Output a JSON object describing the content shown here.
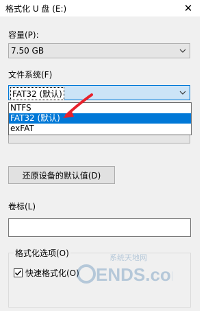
{
  "window": {
    "title": "格式化 U 盘 (E:)",
    "close_glyph": "✕"
  },
  "capacity": {
    "label": "容量(P):",
    "value": "7.50 GB"
  },
  "filesystem": {
    "label": "文件系统(F)",
    "value": "FAT32 (默认)",
    "options": [
      "NTFS",
      "FAT32 (默认)",
      "exFAT"
    ],
    "selected_index": 1
  },
  "restore_button": {
    "label": "还原设备的默认值(D)"
  },
  "volume_label": {
    "label": "卷标(L)",
    "value": ""
  },
  "format_options": {
    "title": "格式化选项(O)",
    "quick_format": {
      "label": "快速格式化(O)",
      "checked": true
    }
  },
  "watermark": {
    "text": "ENDS.com",
    "subtext": "系统天地网"
  },
  "colors": {
    "selection": "#0078d7",
    "annotation_arrow": "#e8222c",
    "dialog_bg": "#f0f0f0"
  },
  "icons": {
    "close": "close-icon",
    "dropdown": "chevron-down-icon",
    "check": "checkmark-icon"
  }
}
